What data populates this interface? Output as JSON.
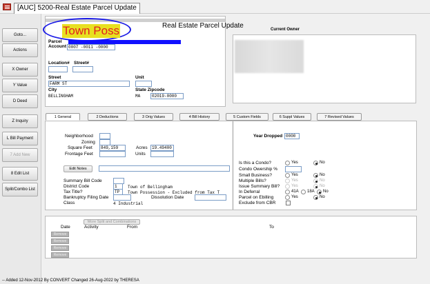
{
  "window": {
    "title": "[AUC] 5200-Real Estate Parcel Update",
    "icon": "app-menu-icon"
  },
  "annotation": {
    "text": "Town Poss",
    "ellipse_color": "#1c1ce6",
    "text_color": "#e02020",
    "highlight": "#e8e020"
  },
  "header": {
    "title": "Real Estate Parcel Update",
    "current_owner_label": "Current Owner"
  },
  "sidebar": {
    "items": [
      {
        "label": "Goto...",
        "enabled": true
      },
      {
        "label": "Actions",
        "enabled": true
      },
      {
        "label": "X Owner",
        "enabled": true
      },
      {
        "label": "Y Value",
        "enabled": true
      },
      {
        "label": "D Deed",
        "enabled": true
      },
      {
        "label": "Z Inquiry",
        "enabled": true
      },
      {
        "label": "L Bill Payment",
        "enabled": true
      },
      {
        "label": "7 Add New",
        "enabled": false
      },
      {
        "label": "8 Edit List",
        "enabled": true
      },
      {
        "label": "Split/Combo List",
        "enabled": true
      }
    ]
  },
  "parcel": {
    "parcel_label": "Parcel",
    "account_label": "Account",
    "account_value": "0007    -0011    -0000",
    "location_label": "Location#",
    "street_num_label": "Street#",
    "street_label": "Street",
    "street_value": "FARM ST",
    "unit_label": "Unit",
    "city_label": "City",
    "city_value": "BELLINGHAM",
    "state_zip_label": "State Zipcode",
    "state_value": "MA",
    "zip_value": "02019-0000"
  },
  "tabs": [
    "1 General",
    "2 Deductions",
    "3 Orig Values",
    "4 Bill History",
    "5 Custom Fields",
    "6 Suppl Values",
    "7 Revised Values"
  ],
  "general": {
    "neighborhood_label": "Neighborhood",
    "zoning_label": "Zoning",
    "square_feet_label": "Square Feet",
    "square_feet_value": "849,159",
    "acres_label": "Acres",
    "acres_value": "19.49400",
    "frontage_label": "Frontage Feet",
    "units_label": "Units",
    "edit_notes_label": "Edit Notes",
    "summary_bill_code_label": "Summary Bill Code",
    "district_code_label": "District Code",
    "district_code_value": "1",
    "district_desc": "Town of Bellingham",
    "tax_title_label": "Tax Title?",
    "tax_title_value": "TP",
    "tax_title_desc": "Town Possession - Excluded from Tax T",
    "bankruptcy_label": "Bankruptcy Filing Date",
    "dissolution_label": "Dissolution Date",
    "class_label": "Class",
    "class_value": "4 Industrial"
  },
  "right_panel": {
    "year_dropped_label": "Year Dropped",
    "year_dropped_value": "0000",
    "condo_label": "Is this a Condo?",
    "yes": "Yes",
    "no": "No",
    "condo_ownership_label": "Condo Owership %",
    "small_business_label": "Small Business?",
    "multiple_bills_label": "Multiple Bills?",
    "issue_summary_label": "Issue Summary Bill?",
    "in_deferral_label": "In Deferral",
    "opt_41a": "41A",
    "opt_18a": "18A",
    "parcel_ebilling_label": "Parcel on Ebilling",
    "exclude_cbr_label": "Exclude from CBR"
  },
  "split": {
    "more_button": "More Split and Combinations",
    "date_col": "Date",
    "activity_col": "Activity",
    "from_col": "From",
    "to_col": "To",
    "remove_label": "Remove"
  },
  "status_bar": {
    "text": "-- Added 12-Nov-2012 By CONVERT Changed 26-Aug-2022 by THERESA"
  }
}
